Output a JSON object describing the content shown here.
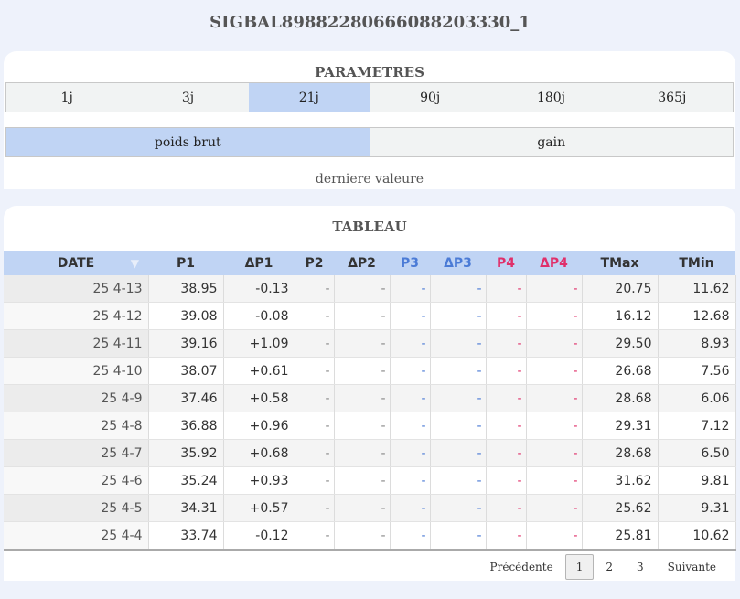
{
  "title": "SIGBAL89882280666088203330_1",
  "parametres": {
    "title": "PARAMETRES",
    "periods": [
      "1j",
      "3j",
      "21j",
      "90j",
      "180j",
      "365j"
    ],
    "active_period": "21j",
    "modes": [
      "poids brut",
      "gain"
    ],
    "active_mode": "poids brut",
    "last_value_label": "derniere valeure"
  },
  "tableau": {
    "title": "TABLEAU",
    "headers": [
      "DATE",
      "P1",
      "ΔP1",
      "P2",
      "ΔP2",
      "P3",
      "ΔP3",
      "P4",
      "ΔP4",
      "TMax",
      "TMin"
    ],
    "rows": [
      [
        "25 4-13",
        "38.95",
        "-0.13",
        "-",
        "-",
        "-",
        "-",
        "-",
        "-",
        "20.75",
        "11.62"
      ],
      [
        "25 4-12",
        "39.08",
        "-0.08",
        "-",
        "-",
        "-",
        "-",
        "-",
        "-",
        "16.12",
        "12.68"
      ],
      [
        "25 4-11",
        "39.16",
        "+1.09",
        "-",
        "-",
        "-",
        "-",
        "-",
        "-",
        "29.50",
        "8.93"
      ],
      [
        "25 4-10",
        "38.07",
        "+0.61",
        "-",
        "-",
        "-",
        "-",
        "-",
        "-",
        "26.68",
        "7.56"
      ],
      [
        "25 4-9",
        "37.46",
        "+0.58",
        "-",
        "-",
        "-",
        "-",
        "-",
        "-",
        "28.68",
        "6.06"
      ],
      [
        "25 4-8",
        "36.88",
        "+0.96",
        "-",
        "-",
        "-",
        "-",
        "-",
        "-",
        "29.31",
        "7.12"
      ],
      [
        "25 4-7",
        "35.92",
        "+0.68",
        "-",
        "-",
        "-",
        "-",
        "-",
        "-",
        "28.68",
        "6.50"
      ],
      [
        "25 4-6",
        "35.24",
        "+0.93",
        "-",
        "-",
        "-",
        "-",
        "-",
        "-",
        "31.62",
        "9.81"
      ],
      [
        "25 4-5",
        "34.31",
        "+0.57",
        "-",
        "-",
        "-",
        "-",
        "-",
        "-",
        "25.62",
        "9.31"
      ],
      [
        "25 4-4",
        "33.74",
        "-0.12",
        "-",
        "-",
        "-",
        "-",
        "-",
        "-",
        "25.81",
        "10.62"
      ]
    ],
    "pagination": {
      "previous": "Précédente",
      "pages": [
        "1",
        "2",
        "3"
      ],
      "current_page": "1",
      "next": "Suivante"
    }
  },
  "colors": {
    "accent": "#c0d4f4",
    "p3": "#4b7bd6",
    "p4": "#e0306a"
  }
}
